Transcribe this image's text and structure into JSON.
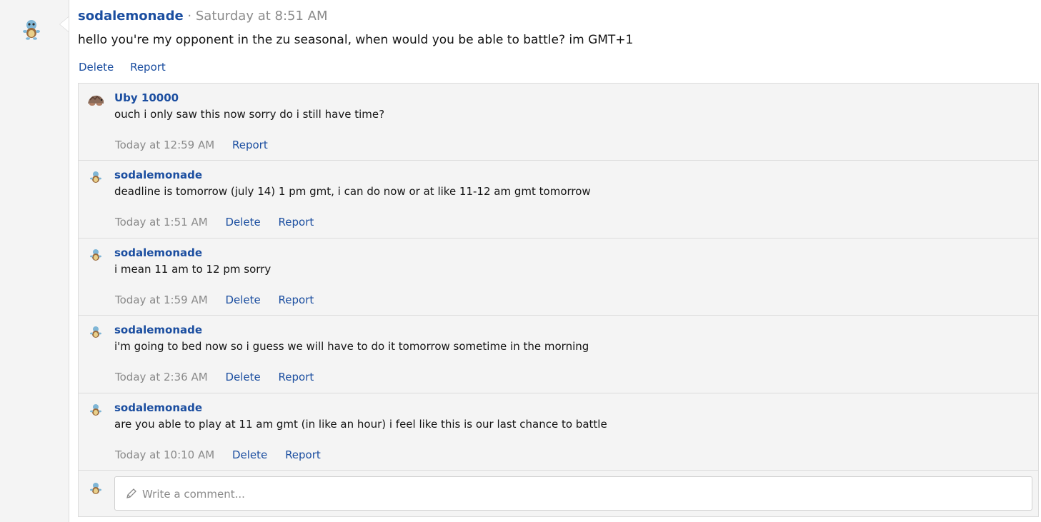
{
  "post": {
    "author": "sodalemonade",
    "separator": "·",
    "time": "Saturday at 8:51 AM",
    "body": "hello you're my opponent in the zu seasonal, when would you be able to battle? im GMT+1",
    "actions": {
      "delete": "Delete",
      "report": "Report"
    }
  },
  "comments": [
    {
      "author": "Uby 10000",
      "avatar": "ground-creature-avatar",
      "text": "ouch i only saw this now sorry do i still have time?",
      "time": "Today at 12:59 AM",
      "delete": "",
      "report": "Report"
    },
    {
      "author": "sodalemonade",
      "avatar": "squirtle-avatar",
      "text": "deadline is tomorrow (july 14) 1 pm gmt, i can do now or at like 11-12 am gmt tomorrow",
      "time": "Today at 1:51 AM",
      "delete": "Delete",
      "report": "Report"
    },
    {
      "author": "sodalemonade",
      "avatar": "squirtle-avatar",
      "text": "i mean 11 am to 12 pm sorry",
      "time": "Today at 1:59 AM",
      "delete": "Delete",
      "report": "Report"
    },
    {
      "author": "sodalemonade",
      "avatar": "squirtle-avatar",
      "text": "i'm going to bed now so i guess we will have to do it tomorrow sometime in the morning",
      "time": "Today at 2:36 AM",
      "delete": "Delete",
      "report": "Report"
    },
    {
      "author": "sodalemonade",
      "avatar": "squirtle-avatar",
      "text": "are you able to play at 11 am gmt (in like an hour) i feel like this is our last chance to battle",
      "time": "Today at 10:10 AM",
      "delete": "Delete",
      "report": "Report"
    }
  ],
  "reply": {
    "placeholder": "Write a comment..."
  },
  "colors": {
    "link": "#1b4ea0",
    "muted": "#8a8a8a",
    "panel": "#f4f4f4",
    "border": "#dcdcdc"
  }
}
